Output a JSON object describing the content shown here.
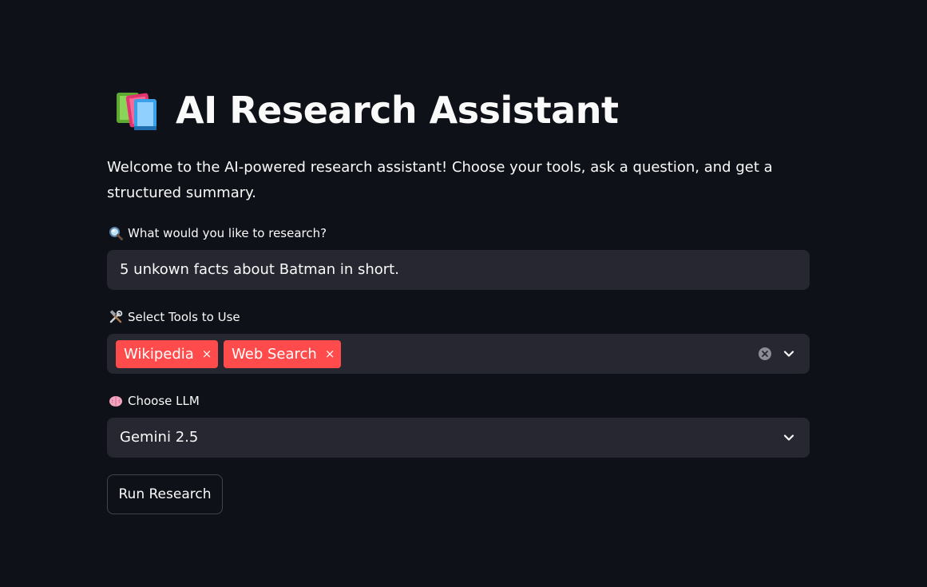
{
  "page": {
    "title": "AI Research Assistant",
    "title_icon": "books-icon",
    "intro": "Welcome to the AI-powered research assistant! Choose your tools, ask a question, and get a structured summary."
  },
  "query": {
    "label": "What would you like to research?",
    "label_icon": "magnifying-glass-icon",
    "value": "5 unkown facts about Batman in short."
  },
  "tools": {
    "label": "Select Tools to Use",
    "label_icon": "hammer-and-wrench-icon",
    "selected": [
      "Wikipedia",
      "Web Search"
    ],
    "remove_symbol": "×"
  },
  "llm": {
    "label": "Choose LLM",
    "label_icon": "brain-icon",
    "selected": "Gemini 2.5"
  },
  "actions": {
    "run_label": "Run Research"
  },
  "colors": {
    "background": "#0e1117",
    "input_background": "#262730",
    "tag_background": "#ff4b4b",
    "text": "#fafafa"
  }
}
